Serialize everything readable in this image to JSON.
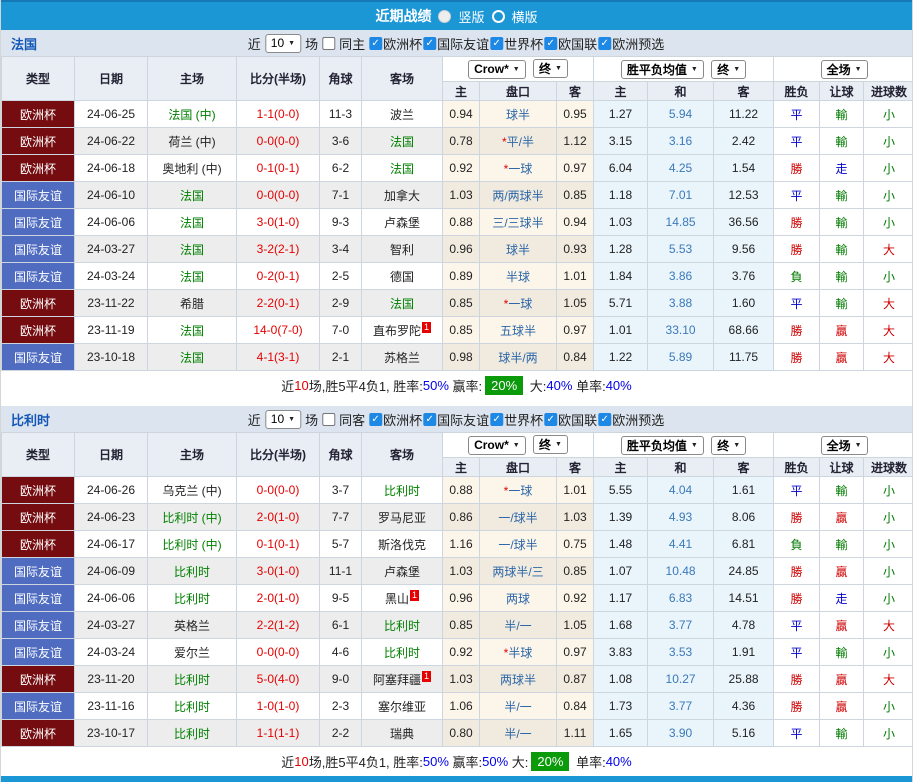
{
  "titlebar": {
    "title": "近期战绩",
    "vertical_label": "竖版",
    "horizontal_label": "横版",
    "selected_layout": "竖版"
  },
  "filters": {
    "near": "近",
    "count": "10",
    "games": "场",
    "leagues": [
      "欧洲杯",
      "国际友谊",
      "世界杯",
      "欧国联",
      "欧洲预选"
    ]
  },
  "controls": {
    "bookmaker": "Crow*",
    "final": "终",
    "avg": "胜平负均值",
    "scope": "全场"
  },
  "headers": {
    "type": "类型",
    "date": "日期",
    "home": "主场",
    "score": "比分(半场)",
    "corner": "角球",
    "away": "客场",
    "h": "主",
    "handicap": "盘口",
    "a": "客",
    "avg_h": "主",
    "avg_d": "和",
    "avg_a": "客",
    "result": "胜负",
    "let_ball": "让球",
    "goals": "进球数"
  },
  "colors": {
    "topbar_blue": "#1b97d6",
    "section_head": "#dce4ef",
    "type_euro_red": "#750d10",
    "type_friendly_blue": "#4f6cc0",
    "focal_green": "#008000",
    "score_red": "#e60000",
    "badge_green": "#0a9a0a",
    "percent_blue": "#0000ee"
  },
  "sections": [
    {
      "team": "法国",
      "same_side_label": "同主",
      "same_side_checked": false,
      "rows": [
        {
          "type": "欧洲杯",
          "date": "24-06-25",
          "home": "法国 (中)",
          "home_focal": true,
          "score": "1-1(0-0)",
          "corner": "11-3",
          "away": "波兰",
          "away_focal": false,
          "away_sup": "",
          "ch": "0.94",
          "star": "",
          "handicap": "球半",
          "ca": "0.95",
          "ah": "1.27",
          "ad": "5.94",
          "aa": "11.22",
          "res": "平",
          "let": "輸",
          "goal": "小"
        },
        {
          "type": "欧洲杯",
          "date": "24-06-22",
          "home": "荷兰 (中)",
          "home_focal": false,
          "score": "0-0(0-0)",
          "corner": "3-6",
          "away": "法国",
          "away_focal": true,
          "away_sup": "",
          "ch": "0.78",
          "star": "*",
          "handicap": "平/半",
          "ca": "1.12",
          "ah": "3.15",
          "ad": "3.16",
          "aa": "2.42",
          "res": "平",
          "let": "輸",
          "goal": "小"
        },
        {
          "type": "欧洲杯",
          "date": "24-06-18",
          "home": "奥地利 (中)",
          "home_focal": false,
          "score": "0-1(0-1)",
          "corner": "6-2",
          "away": "法国",
          "away_focal": true,
          "away_sup": "",
          "ch": "0.92",
          "star": "*",
          "handicap": "一球",
          "ca": "0.97",
          "ah": "6.04",
          "ad": "4.25",
          "aa": "1.54",
          "res": "勝",
          "let": "走",
          "goal": "小"
        },
        {
          "type": "国际友谊",
          "date": "24-06-10",
          "home": "法国",
          "home_focal": true,
          "score": "0-0(0-0)",
          "corner": "7-1",
          "away": "加拿大",
          "away_focal": false,
          "away_sup": "",
          "ch": "1.03",
          "star": "",
          "handicap": "两/两球半",
          "ca": "0.85",
          "ah": "1.18",
          "ad": "7.01",
          "aa": "12.53",
          "res": "平",
          "let": "輸",
          "goal": "小"
        },
        {
          "type": "国际友谊",
          "date": "24-06-06",
          "home": "法国",
          "home_focal": true,
          "score": "3-0(1-0)",
          "corner": "9-3",
          "away": "卢森堡",
          "away_focal": false,
          "away_sup": "",
          "ch": "0.88",
          "star": "",
          "handicap": "三/三球半",
          "ca": "0.94",
          "ah": "1.03",
          "ad": "14.85",
          "aa": "36.56",
          "res": "勝",
          "let": "輸",
          "goal": "小"
        },
        {
          "type": "国际友谊",
          "date": "24-03-27",
          "home": "法国",
          "home_focal": true,
          "score": "3-2(2-1)",
          "corner": "3-4",
          "away": "智利",
          "away_focal": false,
          "away_sup": "",
          "ch": "0.96",
          "star": "",
          "handicap": "球半",
          "ca": "0.93",
          "ah": "1.28",
          "ad": "5.53",
          "aa": "9.56",
          "res": "勝",
          "let": "輸",
          "goal": "大"
        },
        {
          "type": "国际友谊",
          "date": "24-03-24",
          "home": "法国",
          "home_focal": true,
          "score": "0-2(0-1)",
          "corner": "2-5",
          "away": "德国",
          "away_focal": false,
          "away_sup": "",
          "ch": "0.89",
          "star": "",
          "handicap": "半球",
          "ca": "1.01",
          "ah": "1.84",
          "ad": "3.86",
          "aa": "3.76",
          "res": "負",
          "let": "輸",
          "goal": "小"
        },
        {
          "type": "欧洲杯",
          "date": "23-11-22",
          "home": "希腊",
          "home_focal": false,
          "score": "2-2(0-1)",
          "corner": "2-9",
          "away": "法国",
          "away_focal": true,
          "away_sup": "",
          "ch": "0.85",
          "star": "*",
          "handicap": "一球",
          "ca": "1.05",
          "ah": "5.71",
          "ad": "3.88",
          "aa": "1.60",
          "res": "平",
          "let": "輸",
          "goal": "大"
        },
        {
          "type": "欧洲杯",
          "date": "23-11-19",
          "home": "法国",
          "home_focal": true,
          "score": "14-0(7-0)",
          "corner": "7-0",
          "away": "直布罗陀",
          "away_focal": false,
          "away_sup": "1",
          "ch": "0.85",
          "star": "",
          "handicap": "五球半",
          "ca": "0.97",
          "ah": "1.01",
          "ad": "33.10",
          "aa": "68.66",
          "res": "勝",
          "let": "贏",
          "goal": "大"
        },
        {
          "type": "国际友谊",
          "date": "23-10-18",
          "home": "法国",
          "home_focal": true,
          "score": "4-1(3-1)",
          "corner": "2-1",
          "away": "苏格兰",
          "away_focal": false,
          "away_sup": "",
          "ch": "0.98",
          "star": "",
          "handicap": "球半/两",
          "ca": "0.84",
          "ah": "1.22",
          "ad": "5.89",
          "aa": "11.75",
          "res": "勝",
          "let": "贏",
          "goal": "大"
        }
      ],
      "summary": [
        {
          "t": "近",
          "c": "k"
        },
        {
          "t": "10",
          "c": "r"
        },
        {
          "t": "场,胜5平4负1, 胜率:",
          "c": "k"
        },
        {
          "t": "50%",
          "c": "b"
        },
        {
          "t": " 赢率:",
          "c": "k"
        },
        {
          "t": "20%",
          "c": "g"
        },
        {
          "t": " 大:",
          "c": "k"
        },
        {
          "t": "40%",
          "c": "b"
        },
        {
          "t": " 单率:",
          "c": "k"
        },
        {
          "t": "40%",
          "c": "b"
        }
      ]
    },
    {
      "team": "比利时",
      "same_side_label": "同客",
      "same_side_checked": false,
      "rows": [
        {
          "type": "欧洲杯",
          "date": "24-06-26",
          "home": "乌克兰 (中)",
          "home_focal": false,
          "score": "0-0(0-0)",
          "corner": "3-7",
          "away": "比利时",
          "away_focal": true,
          "away_sup": "",
          "ch": "0.88",
          "star": "*",
          "handicap": "一球",
          "ca": "1.01",
          "ah": "5.55",
          "ad": "4.04",
          "aa": "1.61",
          "res": "平",
          "let": "輸",
          "goal": "小"
        },
        {
          "type": "欧洲杯",
          "date": "24-06-23",
          "home": "比利时 (中)",
          "home_focal": true,
          "score": "2-0(1-0)",
          "corner": "7-7",
          "away": "罗马尼亚",
          "away_focal": false,
          "away_sup": "",
          "ch": "0.86",
          "star": "",
          "handicap": "一/球半",
          "ca": "1.03",
          "ah": "1.39",
          "ad": "4.93",
          "aa": "8.06",
          "res": "勝",
          "let": "贏",
          "goal": "小"
        },
        {
          "type": "欧洲杯",
          "date": "24-06-17",
          "home": "比利时 (中)",
          "home_focal": true,
          "score": "0-1(0-1)",
          "corner": "5-7",
          "away": "斯洛伐克",
          "away_focal": false,
          "away_sup": "",
          "ch": "1.16",
          "star": "",
          "handicap": "一/球半",
          "ca": "0.75",
          "ah": "1.48",
          "ad": "4.41",
          "aa": "6.81",
          "res": "負",
          "let": "輸",
          "goal": "小"
        },
        {
          "type": "国际友谊",
          "date": "24-06-09",
          "home": "比利时",
          "home_focal": true,
          "score": "3-0(1-0)",
          "corner": "11-1",
          "away": "卢森堡",
          "away_focal": false,
          "away_sup": "",
          "ch": "1.03",
          "star": "",
          "handicap": "两球半/三",
          "ca": "0.85",
          "ah": "1.07",
          "ad": "10.48",
          "aa": "24.85",
          "res": "勝",
          "let": "贏",
          "goal": "小"
        },
        {
          "type": "国际友谊",
          "date": "24-06-06",
          "home": "比利时",
          "home_focal": true,
          "score": "2-0(1-0)",
          "corner": "9-5",
          "away": "黑山",
          "away_focal": false,
          "away_sup": "1",
          "ch": "0.96",
          "star": "",
          "handicap": "两球",
          "ca": "0.92",
          "ah": "1.17",
          "ad": "6.83",
          "aa": "14.51",
          "res": "勝",
          "let": "走",
          "goal": "小"
        },
        {
          "type": "国际友谊",
          "date": "24-03-27",
          "home": "英格兰",
          "home_focal": false,
          "score": "2-2(1-2)",
          "corner": "6-1",
          "away": "比利时",
          "away_focal": true,
          "away_sup": "",
          "ch": "0.85",
          "star": "",
          "handicap": "半/一",
          "ca": "1.05",
          "ah": "1.68",
          "ad": "3.77",
          "aa": "4.78",
          "res": "平",
          "let": "贏",
          "goal": "大"
        },
        {
          "type": "国际友谊",
          "date": "24-03-24",
          "home": "爱尔兰",
          "home_focal": false,
          "score": "0-0(0-0)",
          "corner": "4-6",
          "away": "比利时",
          "away_focal": true,
          "away_sup": "",
          "ch": "0.92",
          "star": "*",
          "handicap": "半球",
          "ca": "0.97",
          "ah": "3.83",
          "ad": "3.53",
          "aa": "1.91",
          "res": "平",
          "let": "輸",
          "goal": "小"
        },
        {
          "type": "欧洲杯",
          "date": "23-11-20",
          "home": "比利时",
          "home_focal": true,
          "score": "5-0(4-0)",
          "corner": "9-0",
          "away": "阿塞拜疆",
          "away_focal": false,
          "away_sup": "1",
          "ch": "1.03",
          "star": "",
          "handicap": "两球半",
          "ca": "0.87",
          "ah": "1.08",
          "ad": "10.27",
          "aa": "25.88",
          "res": "勝",
          "let": "贏",
          "goal": "大"
        },
        {
          "type": "国际友谊",
          "date": "23-11-16",
          "home": "比利时",
          "home_focal": true,
          "score": "1-0(1-0)",
          "corner": "2-3",
          "away": "塞尔维亚",
          "away_focal": false,
          "away_sup": "",
          "ch": "1.06",
          "star": "",
          "handicap": "半/一",
          "ca": "0.84",
          "ah": "1.73",
          "ad": "3.77",
          "aa": "4.36",
          "res": "勝",
          "let": "贏",
          "goal": "小"
        },
        {
          "type": "欧洲杯",
          "date": "23-10-17",
          "home": "比利时",
          "home_focal": true,
          "score": "1-1(1-1)",
          "corner": "2-2",
          "away": "瑞典",
          "away_focal": false,
          "away_sup": "",
          "ch": "0.80",
          "star": "",
          "handicap": "半/一",
          "ca": "1.11",
          "ah": "1.65",
          "ad": "3.90",
          "aa": "5.16",
          "res": "平",
          "let": "輸",
          "goal": "小"
        }
      ],
      "summary": [
        {
          "t": "近",
          "c": "k"
        },
        {
          "t": "10",
          "c": "r"
        },
        {
          "t": "场,胜5平4负1, 胜率:",
          "c": "k"
        },
        {
          "t": "50%",
          "c": "b"
        },
        {
          "t": " 赢率:",
          "c": "k"
        },
        {
          "t": "50%",
          "c": "b"
        },
        {
          "t": " 大:",
          "c": "k"
        },
        {
          "t": "20%",
          "c": "g"
        },
        {
          "t": " 单率:",
          "c": "k"
        },
        {
          "t": "40%",
          "c": "b"
        }
      ]
    }
  ]
}
